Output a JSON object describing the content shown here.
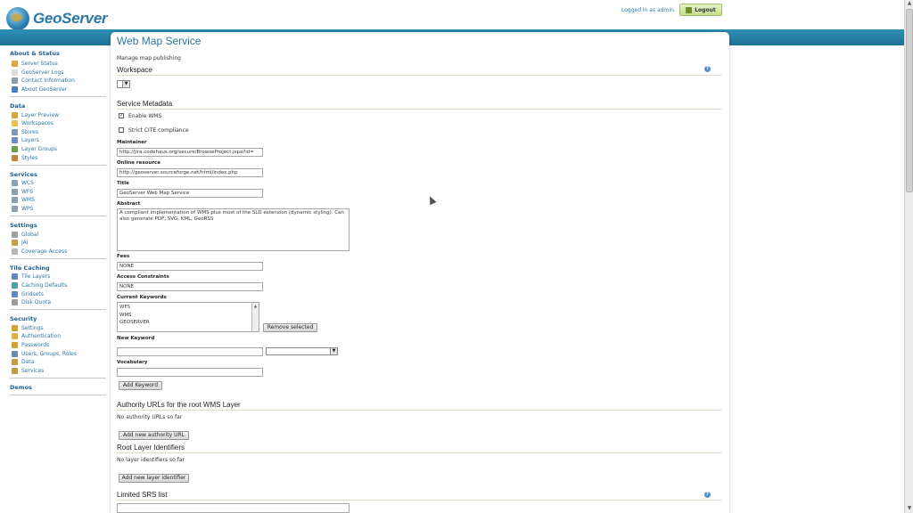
{
  "app": {
    "name": "GeoServer"
  },
  "header": {
    "logged_in_text": "Logged in as admin.",
    "logout_label": "Logout"
  },
  "sidebar": {
    "sections": [
      {
        "title": "About & Status",
        "items": [
          {
            "label": "Server Status",
            "icon": "server-status-icon",
            "color": "#e0a43a"
          },
          {
            "label": "GeoServer Logs",
            "icon": "logs-icon",
            "color": "#dcdcdc"
          },
          {
            "label": "Contact Information",
            "icon": "contact-icon",
            "color": "#8a9cb0"
          },
          {
            "label": "About GeoServer",
            "icon": "info-icon",
            "color": "#4d7fc0"
          }
        ]
      },
      {
        "title": "Data",
        "items": [
          {
            "label": "Layer Preview",
            "icon": "layer-preview-icon",
            "color": "#d9a43c"
          },
          {
            "label": "Workspaces",
            "icon": "folder-icon",
            "color": "#e8c24a"
          },
          {
            "label": "Stores",
            "icon": "stores-icon",
            "color": "#7d98b8"
          },
          {
            "label": "Layers",
            "icon": "layers-icon",
            "color": "#6a8fc0"
          },
          {
            "label": "Layer Groups",
            "icon": "layer-groups-icon",
            "color": "#6aa048"
          },
          {
            "label": "Styles",
            "icon": "palette-icon",
            "color": "#c8863a"
          }
        ]
      },
      {
        "title": "Services",
        "items": [
          {
            "label": "WCS",
            "icon": "wcs-icon",
            "color": "#8aa0b8"
          },
          {
            "label": "WFS",
            "icon": "wfs-icon",
            "color": "#8aa0b8"
          },
          {
            "label": "WMS",
            "icon": "wms-icon",
            "color": "#8aa0b8"
          },
          {
            "label": "WPS",
            "icon": "wps-icon",
            "color": "#8aa0b8"
          }
        ]
      },
      {
        "title": "Settings",
        "items": [
          {
            "label": "Global",
            "icon": "global-icon",
            "color": "#9aa0a8"
          },
          {
            "label": "JAI",
            "icon": "jai-icon",
            "color": "#c8a040"
          },
          {
            "label": "Coverage Access",
            "icon": "coverage-access-icon",
            "color": "#b0b8c0"
          }
        ]
      },
      {
        "title": "Tile Caching",
        "items": [
          {
            "label": "Tile Layers",
            "icon": "tile-layers-icon",
            "color": "#5f88c4"
          },
          {
            "label": "Caching Defaults",
            "icon": "caching-defaults-icon",
            "color": "#4aa0b0"
          },
          {
            "label": "Gridsets",
            "icon": "gridsets-icon",
            "color": "#5f88c4"
          },
          {
            "label": "Disk Quota",
            "icon": "disk-quota-icon",
            "color": "#9a9a9a"
          }
        ]
      },
      {
        "title": "Security",
        "items": [
          {
            "label": "Settings",
            "icon": "key-icon",
            "color": "#d0a030"
          },
          {
            "label": "Authentication",
            "icon": "authentication-icon",
            "color": "#e0b040"
          },
          {
            "label": "Passwords",
            "icon": "passwords-icon",
            "color": "#d0a030"
          },
          {
            "label": "Users, Groups, Roles",
            "icon": "users-icon",
            "color": "#6a8ab0"
          },
          {
            "label": "Data",
            "icon": "data-security-icon",
            "color": "#c89a40"
          },
          {
            "label": "Services",
            "icon": "services-security-icon",
            "color": "#c89a40"
          }
        ]
      },
      {
        "title": "Demos",
        "items": []
      }
    ]
  },
  "main": {
    "title": "Web Map Service",
    "description": "Manage map publishing",
    "workspace": {
      "heading": "Workspace"
    },
    "service_metadata": {
      "heading": "Service Metadata",
      "enable_wms": {
        "label": "Enable WMS",
        "checked": true
      },
      "strict_cite": {
        "label": "Strict CITE compliance",
        "checked": false
      },
      "maintainer": {
        "label": "Maintainer",
        "value": "http://jira.codehaus.org/secure/BrowseProject.jspa?id="
      },
      "online_resource": {
        "label": "Online resource",
        "value": "http://geoserver.sourceforge.net/html/index.php"
      },
      "title": {
        "label": "Title",
        "value": "GeoServer Web Map Service"
      },
      "abstract": {
        "label": "Abstract",
        "value": "A compliant implementation of WMS plus most of the SLD extension (dynamic styling). Can also generate PDF, SVG, KML, GeoRSS"
      },
      "fees": {
        "label": "Fees",
        "value": "NONE"
      },
      "access_constraints": {
        "label": "Access Constraints",
        "value": "NONE"
      },
      "current_keywords": {
        "label": "Current Keywords",
        "items": [
          "WFS",
          "WMS",
          "GEOSERVER"
        ],
        "remove_label": "Remove selected"
      },
      "new_keyword": {
        "label": "New Keyword",
        "value": ""
      },
      "vocabulary": {
        "label": "Vocabulary",
        "value": ""
      },
      "add_keyword_label": "Add Keyword"
    },
    "authority_urls": {
      "heading": "Authority URLs for the root WMS Layer",
      "empty_text": "No authority URLs so far",
      "add_label": "Add new authority URL"
    },
    "root_layer_identifiers": {
      "heading": "Root Layer Identifiers",
      "empty_text": "No layer identifiers so far",
      "add_label": "Add new layer identifier"
    },
    "limited_srs": {
      "heading": "Limited SRS list"
    }
  }
}
